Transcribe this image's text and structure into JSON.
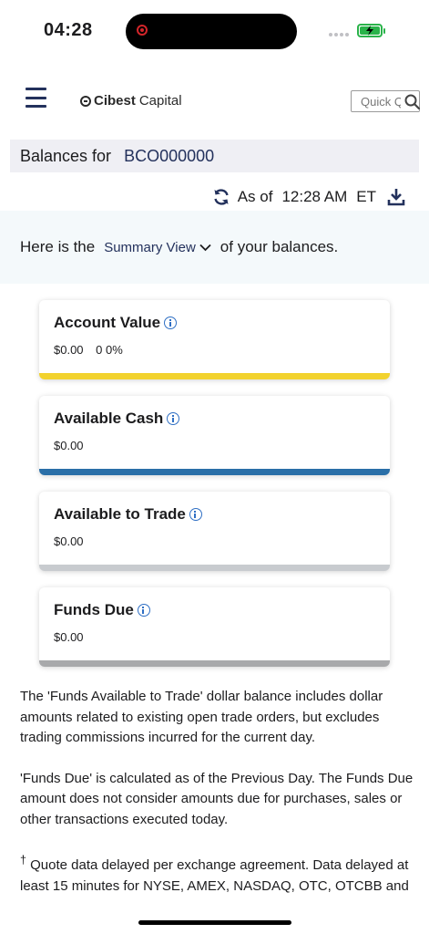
{
  "status_bar": {
    "time": "04:28"
  },
  "header": {
    "logo_bold": "Cibest",
    "logo_light": "Capital",
    "search_placeholder": "Quick Quote"
  },
  "balances": {
    "label": "Balances for",
    "account": "BCO000000"
  },
  "asof": {
    "prefix": "As of",
    "time": "12:28 AM",
    "tz": "ET"
  },
  "summary": {
    "prefix": "Here is the",
    "view": "Summary View",
    "suffix": "of your balances."
  },
  "cards": [
    {
      "title": "Account Value",
      "value": "$0.00",
      "change": "0",
      "pct": "0%",
      "stripe_color": "#f2d22e"
    },
    {
      "title": "Available Cash",
      "value": "$0.00",
      "stripe_color": "#2a6fa8"
    },
    {
      "title": "Available to Trade",
      "value": "$0.00",
      "stripe_color": "#c8cbcf"
    },
    {
      "title": "Funds Due",
      "value": "$0.00",
      "stripe_color": "#a8a9ab"
    }
  ],
  "notes": [
    "The 'Funds Available to Trade' dollar balance includes dollar amounts related to existing open trade orders, but excludes trading commissions incurred for the current day.",
    "'Funds Due' is calculated as of the Previous Day. The Funds Due amount does not consider amounts due for purchases, sales or other transactions executed today.",
    "Quote data delayed per exchange agreement. Data delayed at least 15 minutes for NYSE, AMEX, NASDAQ, OTC, OTCBB and OPRA."
  ],
  "notes_footnote_mark": "†"
}
